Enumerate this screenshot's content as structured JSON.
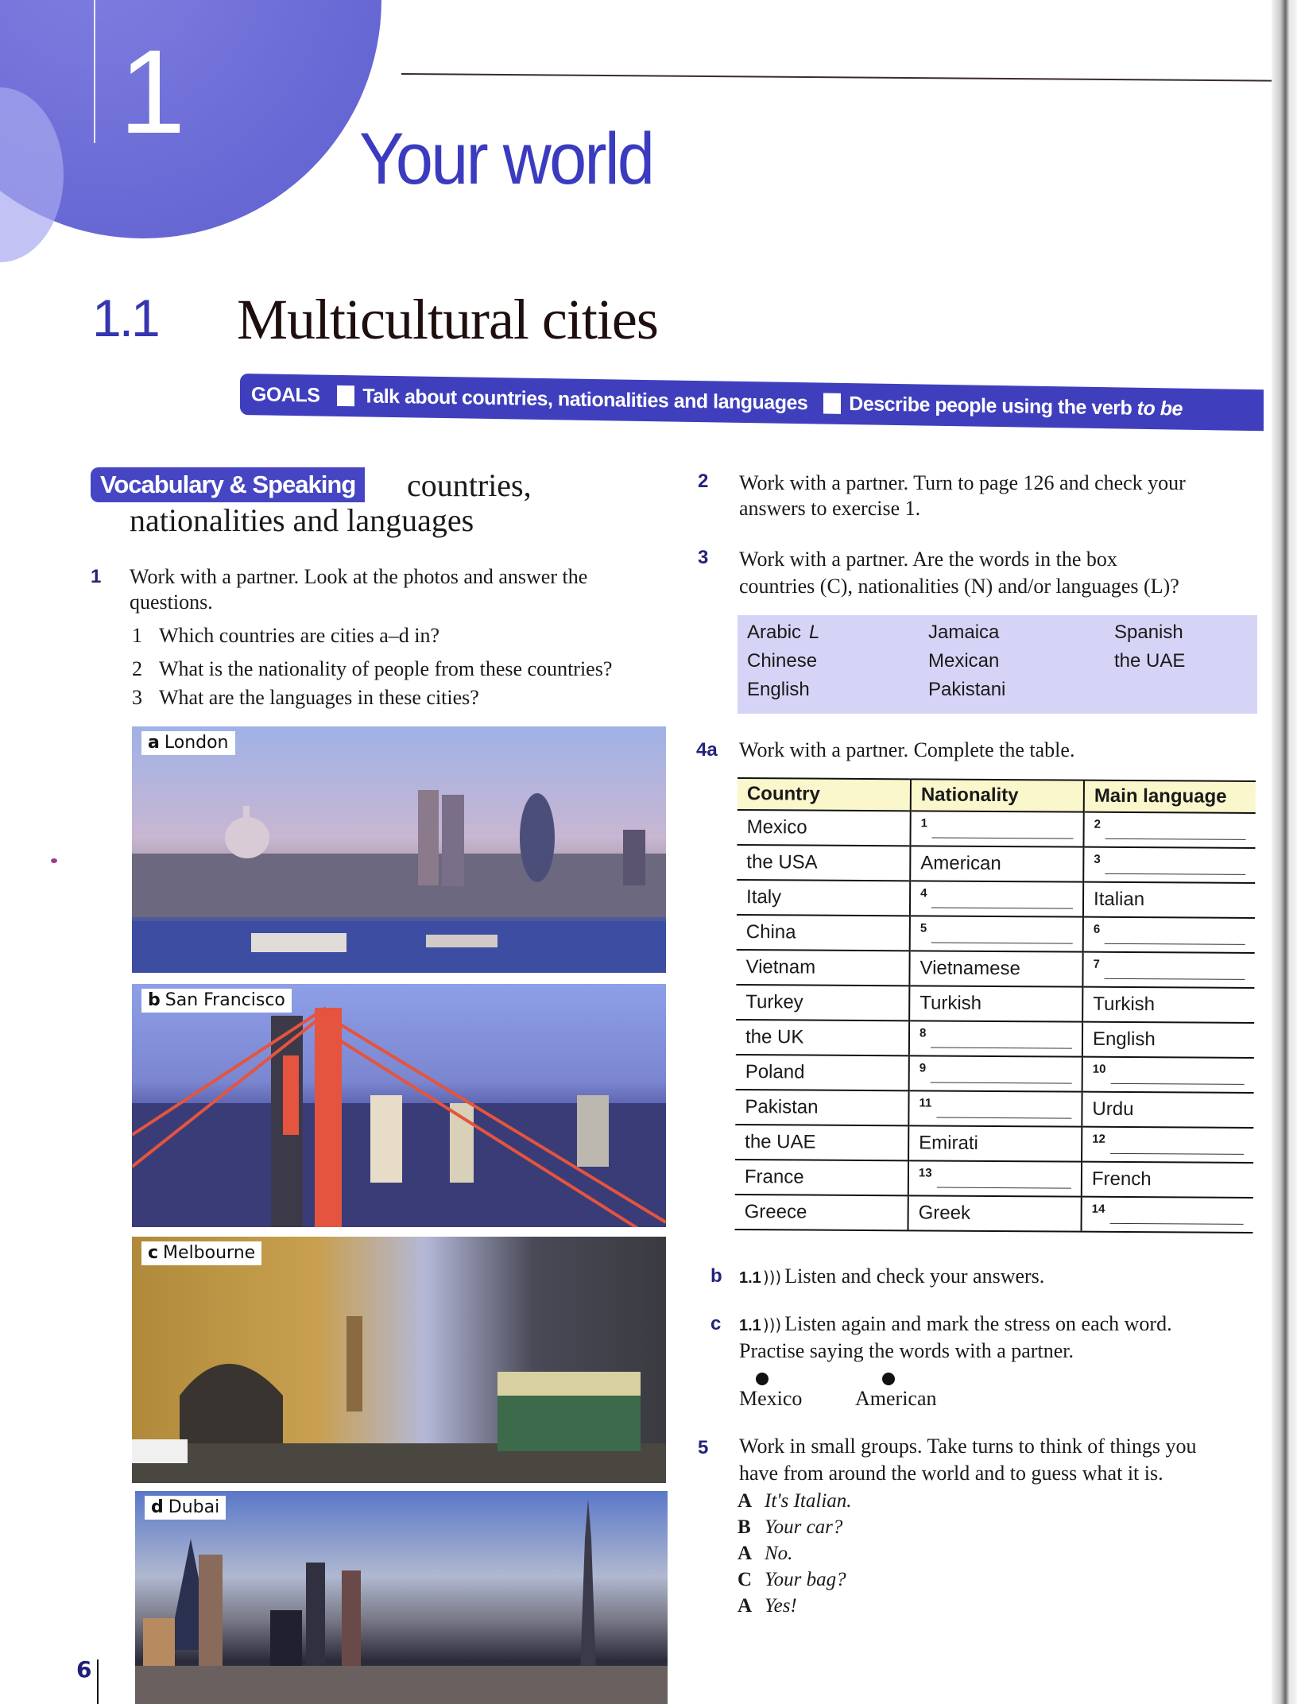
{
  "unit": {
    "number": "1",
    "title": "Your world"
  },
  "lesson": {
    "number": "1.1",
    "title": "Multicultural cities"
  },
  "goals": {
    "label": "GOALS",
    "items": [
      {
        "text": "Talk about countries, nationalities and languages"
      },
      {
        "text": "Describe people using the verb ",
        "emphasis": "to be"
      }
    ]
  },
  "vocabulary_heading": {
    "tag": "Vocabulary & Speaking",
    "topic_line1": "countries,",
    "topic_line2": "nationalities and languages"
  },
  "exercise1": {
    "number": "1",
    "line1": "Work with a partner. Look at the photos and answer the",
    "line2": "questions.",
    "questions": [
      {
        "n": "1",
        "text": "Which countries are cities a–d in?"
      },
      {
        "n": "2",
        "text": "What is the nationality of people from these countries?"
      },
      {
        "n": "3",
        "text": "What are the languages in these cities?"
      }
    ]
  },
  "photos": [
    {
      "letter": "a",
      "city": "London"
    },
    {
      "letter": "b",
      "city": "San Francisco"
    },
    {
      "letter": "c",
      "city": "Melbourne"
    },
    {
      "letter": "d",
      "city": "Dubai"
    }
  ],
  "exercise2": {
    "number": "2",
    "line1": "Work with a partner. Turn to page 126 and check your",
    "line2": "answers to exercise 1."
  },
  "exercise3": {
    "number": "3",
    "line1": "Work with a partner. Are the words in the box",
    "line2": "countries (C), nationalities (N) and/or languages (L)?",
    "word_box": {
      "columns": [
        [
          {
            "word": "Arabic",
            "mark": "L"
          },
          {
            "word": "Chinese"
          },
          {
            "word": "English"
          }
        ],
        [
          {
            "word": "Jamaica"
          },
          {
            "word": "Mexican"
          },
          {
            "word": "Pakistani"
          }
        ],
        [
          {
            "word": "Spanish"
          },
          {
            "word": "the UAE"
          }
        ]
      ]
    }
  },
  "exercise4a": {
    "number": "4a",
    "instruction": "Work with a partner. Complete the table.",
    "table": {
      "headers": [
        "Country",
        "Nationality",
        "Main language"
      ],
      "rows": [
        {
          "country": "Mexico",
          "nationality": {
            "blank": "1"
          },
          "language": {
            "blank": "2"
          }
        },
        {
          "country": "the USA",
          "nationality": {
            "text": "American"
          },
          "language": {
            "blank": "3"
          }
        },
        {
          "country": "Italy",
          "nationality": {
            "blank": "4"
          },
          "language": {
            "text": "Italian"
          }
        },
        {
          "country": "China",
          "nationality": {
            "blank": "5"
          },
          "language": {
            "blank": "6"
          }
        },
        {
          "country": "Vietnam",
          "nationality": {
            "text": "Vietnamese"
          },
          "language": {
            "blank": "7"
          }
        },
        {
          "country": "Turkey",
          "nationality": {
            "text": "Turkish"
          },
          "language": {
            "text": "Turkish"
          }
        },
        {
          "country": "the UK",
          "nationality": {
            "blank": "8"
          },
          "language": {
            "text": "English"
          }
        },
        {
          "country": "Poland",
          "nationality": {
            "blank": "9"
          },
          "language": {
            "blank": "10"
          }
        },
        {
          "country": "Pakistan",
          "nationality": {
            "blank": "11"
          },
          "language": {
            "text": "Urdu"
          }
        },
        {
          "country": "the UAE",
          "nationality": {
            "text": "Emirati"
          },
          "language": {
            "blank": "12"
          }
        },
        {
          "country": "France",
          "nationality": {
            "blank": "13"
          },
          "language": {
            "text": "French"
          }
        },
        {
          "country": "Greece",
          "nationality": {
            "text": "Greek"
          },
          "language": {
            "blank": "14"
          }
        }
      ]
    }
  },
  "exercise4b": {
    "letter": "b",
    "audio": "1.1",
    "text": "Listen and check your answers."
  },
  "exercise4c": {
    "letter": "c",
    "audio": "1.1",
    "line1": "Listen again and mark the stress on each word.",
    "line2": "Practise saying the words with a partner.",
    "examples": [
      "Mexico",
      "American"
    ]
  },
  "exercise5": {
    "number": "5",
    "line1": "Work in small groups. Take turns to think of things you",
    "line2": "have from around the world and to guess what it is.",
    "dialogue": [
      {
        "speaker": "A",
        "line": "It's Italian."
      },
      {
        "speaker": "B",
        "line": "Your car?"
      },
      {
        "speaker": "A",
        "line": "No."
      },
      {
        "speaker": "C",
        "line": "Your bag?"
      },
      {
        "speaker": "A",
        "line": "Yes!"
      }
    ]
  },
  "page_number": "6",
  "icons": {
    "audio": "audio-waves-icon"
  }
}
